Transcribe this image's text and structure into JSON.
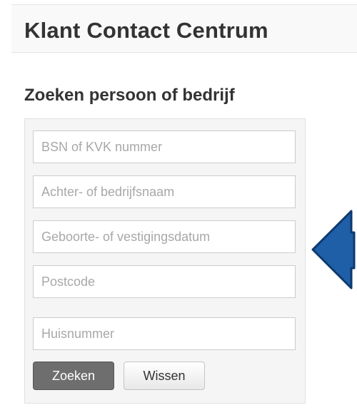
{
  "header": {
    "title": "Klant Contact Centrum"
  },
  "search": {
    "title": "Zoeken persoon of bedrijf",
    "fields": [
      {
        "placeholder": "BSN of KVK nummer"
      },
      {
        "placeholder": "Achter- of bedrijfsnaam"
      },
      {
        "placeholder": "Geboorte- of vestigingsdatum"
      },
      {
        "placeholder": "Postcode"
      },
      {
        "placeholder": "Huisnummer"
      }
    ],
    "search_label": "Zoeken",
    "clear_label": "Wissen"
  },
  "colors": {
    "arrow_fill": "#1f5fa8",
    "arrow_stroke": "#0d3a6e",
    "primary_button": "#6e6e6e"
  },
  "icons": {
    "annotation": "left-arrow-icon"
  }
}
